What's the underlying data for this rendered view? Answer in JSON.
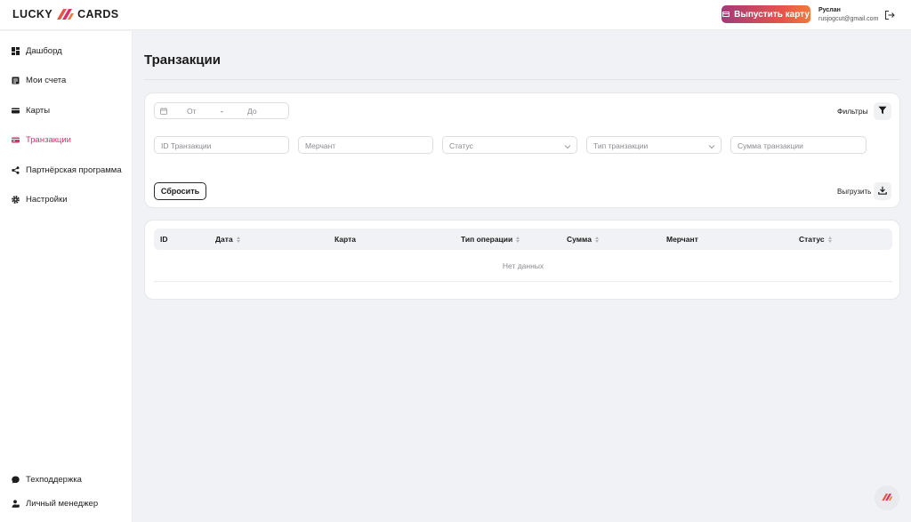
{
  "brand": {
    "left": "LUCKY",
    "right": "CARDS",
    "accent": "#e8554a"
  },
  "header": {
    "issue_card_label": "Выпустить карту",
    "user_name": "Руслан",
    "user_email": "rusjogcut@gmail.com"
  },
  "sidebar": {
    "items": [
      {
        "label": "Дашборд",
        "icon": "dashboard-icon"
      },
      {
        "label": "Мои счета",
        "icon": "accounts-icon"
      },
      {
        "label": "Карты",
        "icon": "card-icon"
      },
      {
        "label": "Транзакции",
        "icon": "transactions-icon",
        "active": true
      },
      {
        "label": "Партнёрская программа",
        "icon": "share-icon"
      },
      {
        "label": "Настройки",
        "icon": "gear-icon"
      }
    ],
    "bottom": [
      {
        "label": "Техподдержка",
        "icon": "chat-icon"
      },
      {
        "label": "Личный менеджер",
        "icon": "manager-icon"
      }
    ],
    "active_color": "#d6326a"
  },
  "page": {
    "title": "Транзакции"
  },
  "filters": {
    "date_from_placeholder": "От",
    "date_separator": "-",
    "date_to_placeholder": "До",
    "filters_label": "Фильтры",
    "id_placeholder": "ID Транзакции",
    "merchant_placeholder": "Мерчант",
    "status_placeholder": "Статус",
    "type_placeholder": "Тип транзакции",
    "amount_placeholder": "Сумма транзакции",
    "reset_label": "Сбросить",
    "export_label": "Выгрузить"
  },
  "table": {
    "columns": [
      "ID",
      "Дата",
      "Карта",
      "Тип операции",
      "Сумма",
      "Мерчант",
      "Статус"
    ],
    "empty_text": "Нет данных"
  }
}
